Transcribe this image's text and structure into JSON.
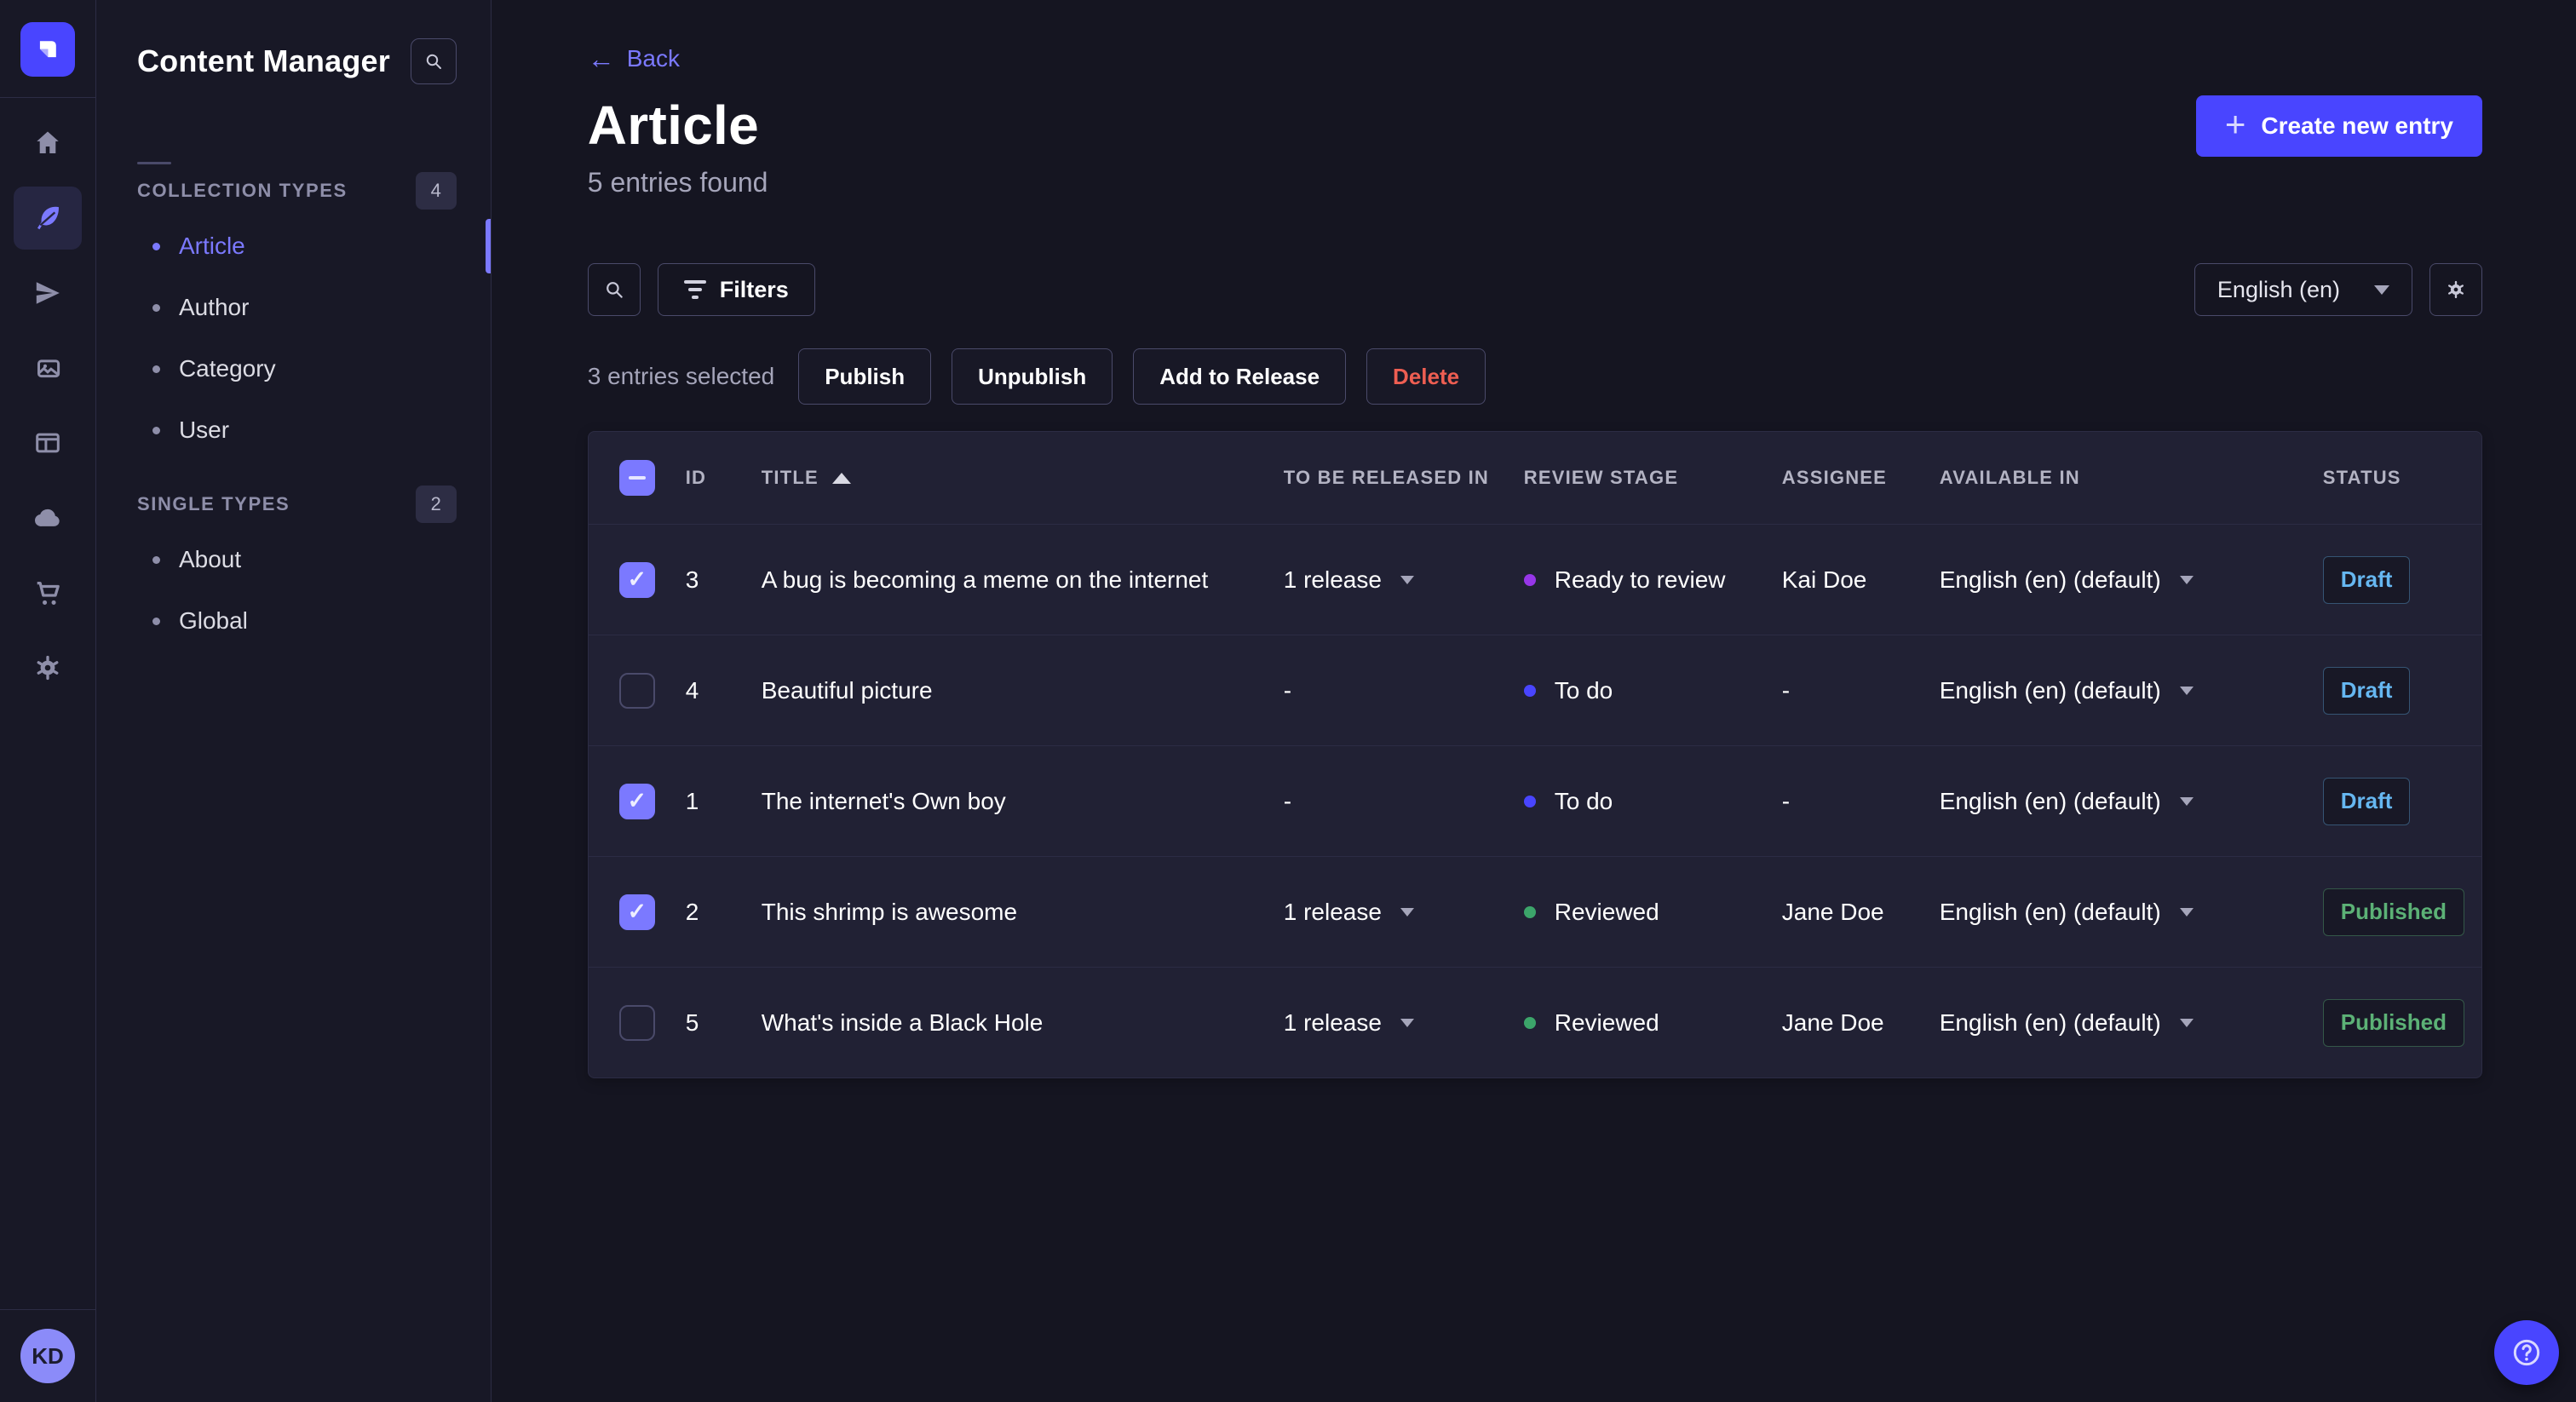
{
  "colors": {
    "primary": "#4945ff",
    "primary_light": "#7b79ff",
    "danger": "#ee5e52",
    "draft": "#66b7f1",
    "published": "#5cb176",
    "bg_page": "#151521",
    "bg_nav": "#181826",
    "bg_card": "#212134",
    "border": "#2c2c44",
    "border_light": "#4a4a6a",
    "text_muted": "#a5a5ba"
  },
  "rail": {
    "icons": [
      {
        "name": "home"
      },
      {
        "name": "content-manager",
        "active": true
      },
      {
        "name": "releases"
      },
      {
        "name": "media-library"
      },
      {
        "name": "content-type-builder"
      },
      {
        "name": "cloud"
      },
      {
        "name": "marketplace"
      },
      {
        "name": "settings"
      }
    ],
    "avatar_initials": "KD"
  },
  "subnav": {
    "title": "Content Manager",
    "sections": [
      {
        "label": "COLLECTION TYPES",
        "badge": "4",
        "items": [
          {
            "label": "Article",
            "active": true
          },
          {
            "label": "Author"
          },
          {
            "label": "Category"
          },
          {
            "label": "User"
          }
        ]
      },
      {
        "label": "SINGLE TYPES",
        "badge": "2",
        "items": [
          {
            "label": "About"
          },
          {
            "label": "Global"
          }
        ]
      }
    ]
  },
  "header": {
    "back_label": "Back",
    "title": "Article",
    "subtitle": "5 entries found",
    "create_button": "Create new entry"
  },
  "toolbar": {
    "filters_label": "Filters",
    "locale_value": "English (en)"
  },
  "selection": {
    "summary": "3 entries selected",
    "publish": "Publish",
    "unpublish": "Unpublish",
    "add_to_release": "Add to Release",
    "delete": "Delete"
  },
  "table": {
    "select_all": "indeterminate",
    "sorted_column": "TITLE",
    "sort_direction": "asc",
    "columns": [
      "ID",
      "TITLE",
      "TO BE RELEASED IN",
      "REVIEW STAGE",
      "ASSIGNEE",
      "AVAILABLE IN",
      "STATUS"
    ],
    "rows": [
      {
        "checked": true,
        "id": "3",
        "title": "A bug is becoming a meme on the internet",
        "release": "1 release",
        "stage": "Ready to review",
        "stage_color": "#9736e8",
        "assignee": "Kai Doe",
        "locale": "English (en) (default)",
        "status": "Draft"
      },
      {
        "checked": false,
        "id": "4",
        "title": "Beautiful picture",
        "release": "-",
        "stage": "To do",
        "stage_color": "#4945ff",
        "assignee": "-",
        "locale": "English (en) (default)",
        "status": "Draft"
      },
      {
        "checked": true,
        "id": "1",
        "title": "The internet's Own boy",
        "release": "-",
        "stage": "To do",
        "stage_color": "#4945ff",
        "assignee": "-",
        "locale": "English (en) (default)",
        "status": "Draft"
      },
      {
        "checked": true,
        "id": "2",
        "title": "This shrimp is awesome",
        "release": "1 release",
        "stage": "Reviewed",
        "stage_color": "#3ca56a",
        "assignee": "Jane Doe",
        "locale": "English (en) (default)",
        "status": "Published"
      },
      {
        "checked": false,
        "id": "5",
        "title": "What's inside a Black Hole",
        "release": "1 release",
        "stage": "Reviewed",
        "stage_color": "#3ca56a",
        "assignee": "Jane Doe",
        "locale": "English (en) (default)",
        "status": "Published"
      }
    ]
  }
}
